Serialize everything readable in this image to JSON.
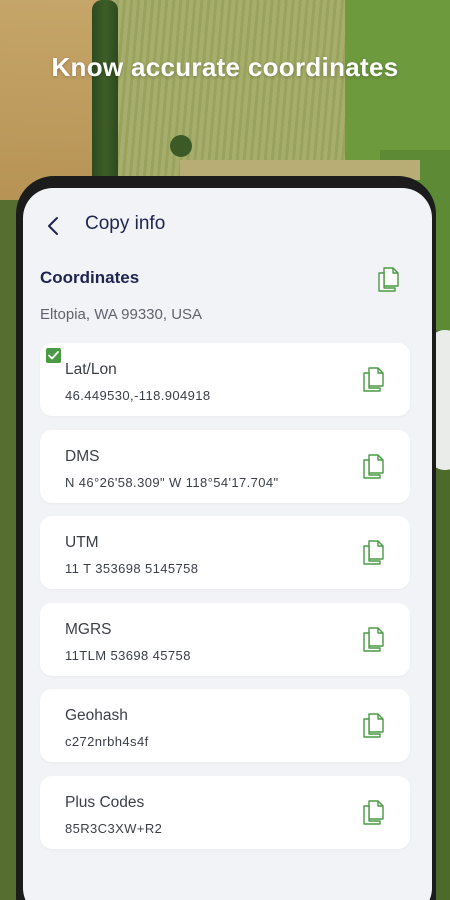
{
  "headline": "Know accurate coordinates",
  "header": {
    "back_icon": "chevron-left-icon",
    "title": "Copy info"
  },
  "section": {
    "title": "Coordinates",
    "copy_icon": "copy-icon",
    "address": "Eltopia, WA 99330, USA"
  },
  "items": [
    {
      "label": "Lat/Lon",
      "value": "46.449530,-118.904918",
      "checked": true
    },
    {
      "label": "DMS",
      "value": "N 46°26'58.309\" W 118°54'17.704\""
    },
    {
      "label": "UTM",
      "value": "11 T 353698 5145758"
    },
    {
      "label": "MGRS",
      "value": "11TLM 53698 45758"
    },
    {
      "label": "Geohash",
      "value": "c272nrbh4s4f"
    },
    {
      "label": "Plus Codes",
      "value": "85R3C3XW+R2"
    }
  ],
  "colors": {
    "accent_green": "#4a9a45",
    "title_navy": "#1f2451",
    "screen_bg": "#f2f3f6"
  }
}
